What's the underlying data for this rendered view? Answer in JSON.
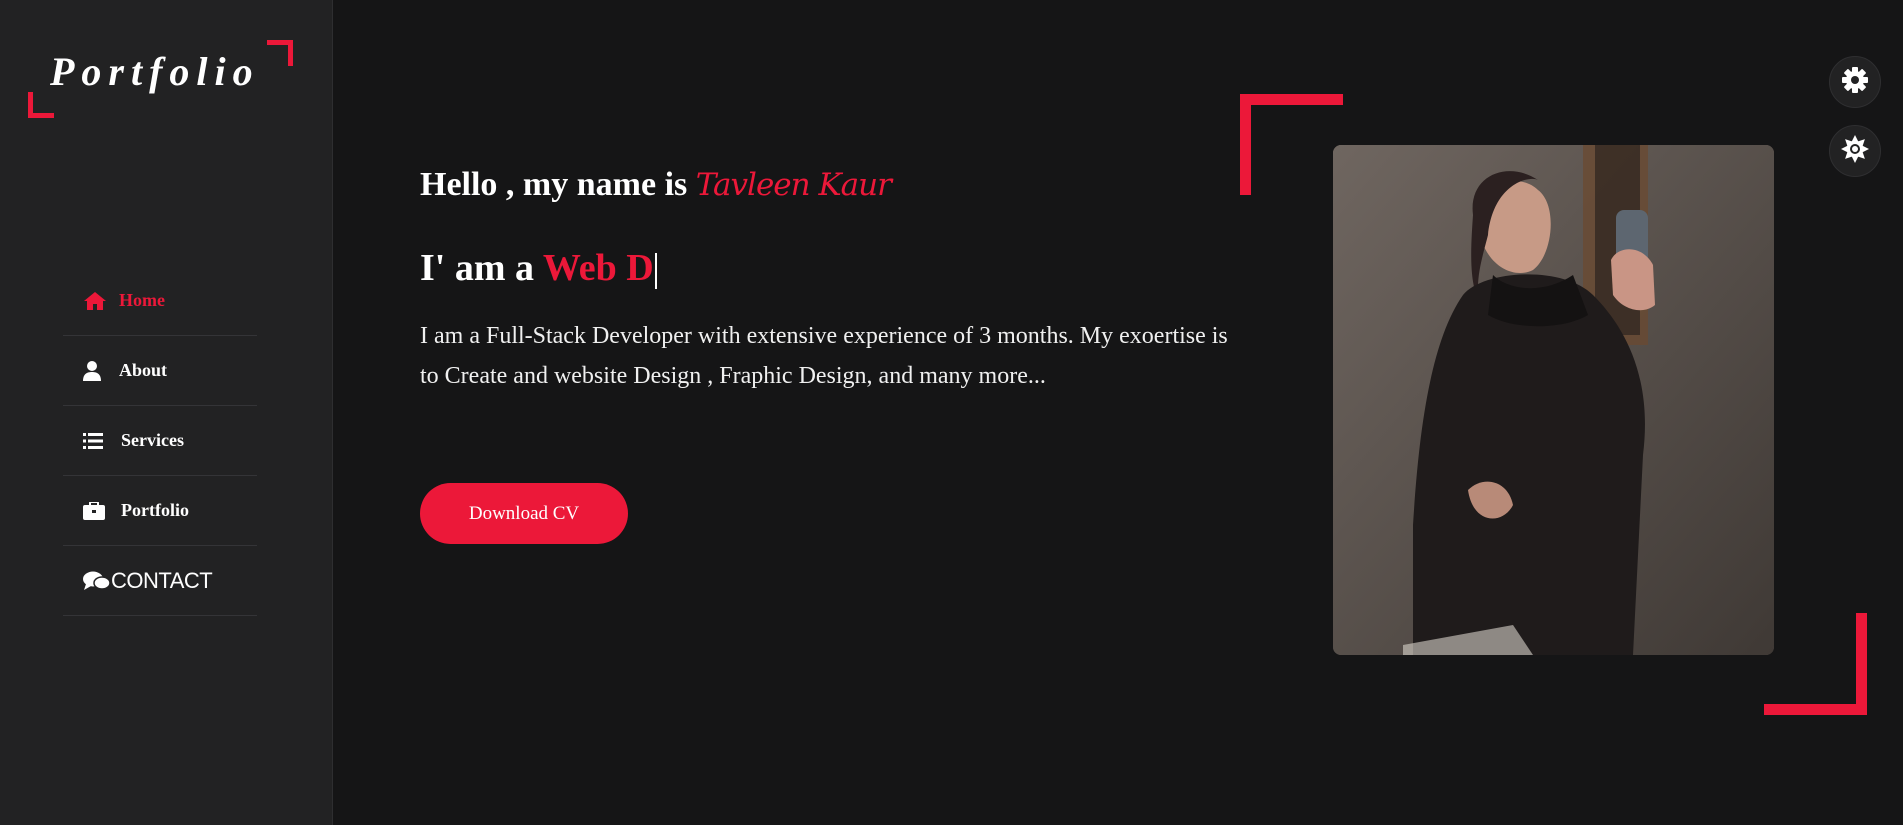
{
  "logo": {
    "text": "Portfolio"
  },
  "nav": {
    "items": [
      {
        "label": "Home",
        "icon": "home-icon",
        "active": true
      },
      {
        "label": "About",
        "icon": "user-icon",
        "active": false
      },
      {
        "label": "Services",
        "icon": "list-icon",
        "active": false
      },
      {
        "label": "Portfolio",
        "icon": "briefcase-icon",
        "active": false
      },
      {
        "label": "CONTACT",
        "icon": "comments-icon",
        "active": false
      }
    ]
  },
  "hero": {
    "hello_prefix": "Hello , my name is ",
    "name": "Tavleen Kaur",
    "iam_prefix": "I' am a ",
    "role_typed": "Web D",
    "description": "I am a Full-Stack Developer with extensive experience of 3 months. My exoertise is to Create and website Design , Fraphic Design, and many more...",
    "button_label": "Download CV"
  },
  "settings": {
    "icons": [
      "gear-icon",
      "sun-icon"
    ]
  },
  "colors": {
    "accent": "#ec1839",
    "background": "#151516",
    "sidebar": "#222223",
    "text": "#ffffff"
  }
}
